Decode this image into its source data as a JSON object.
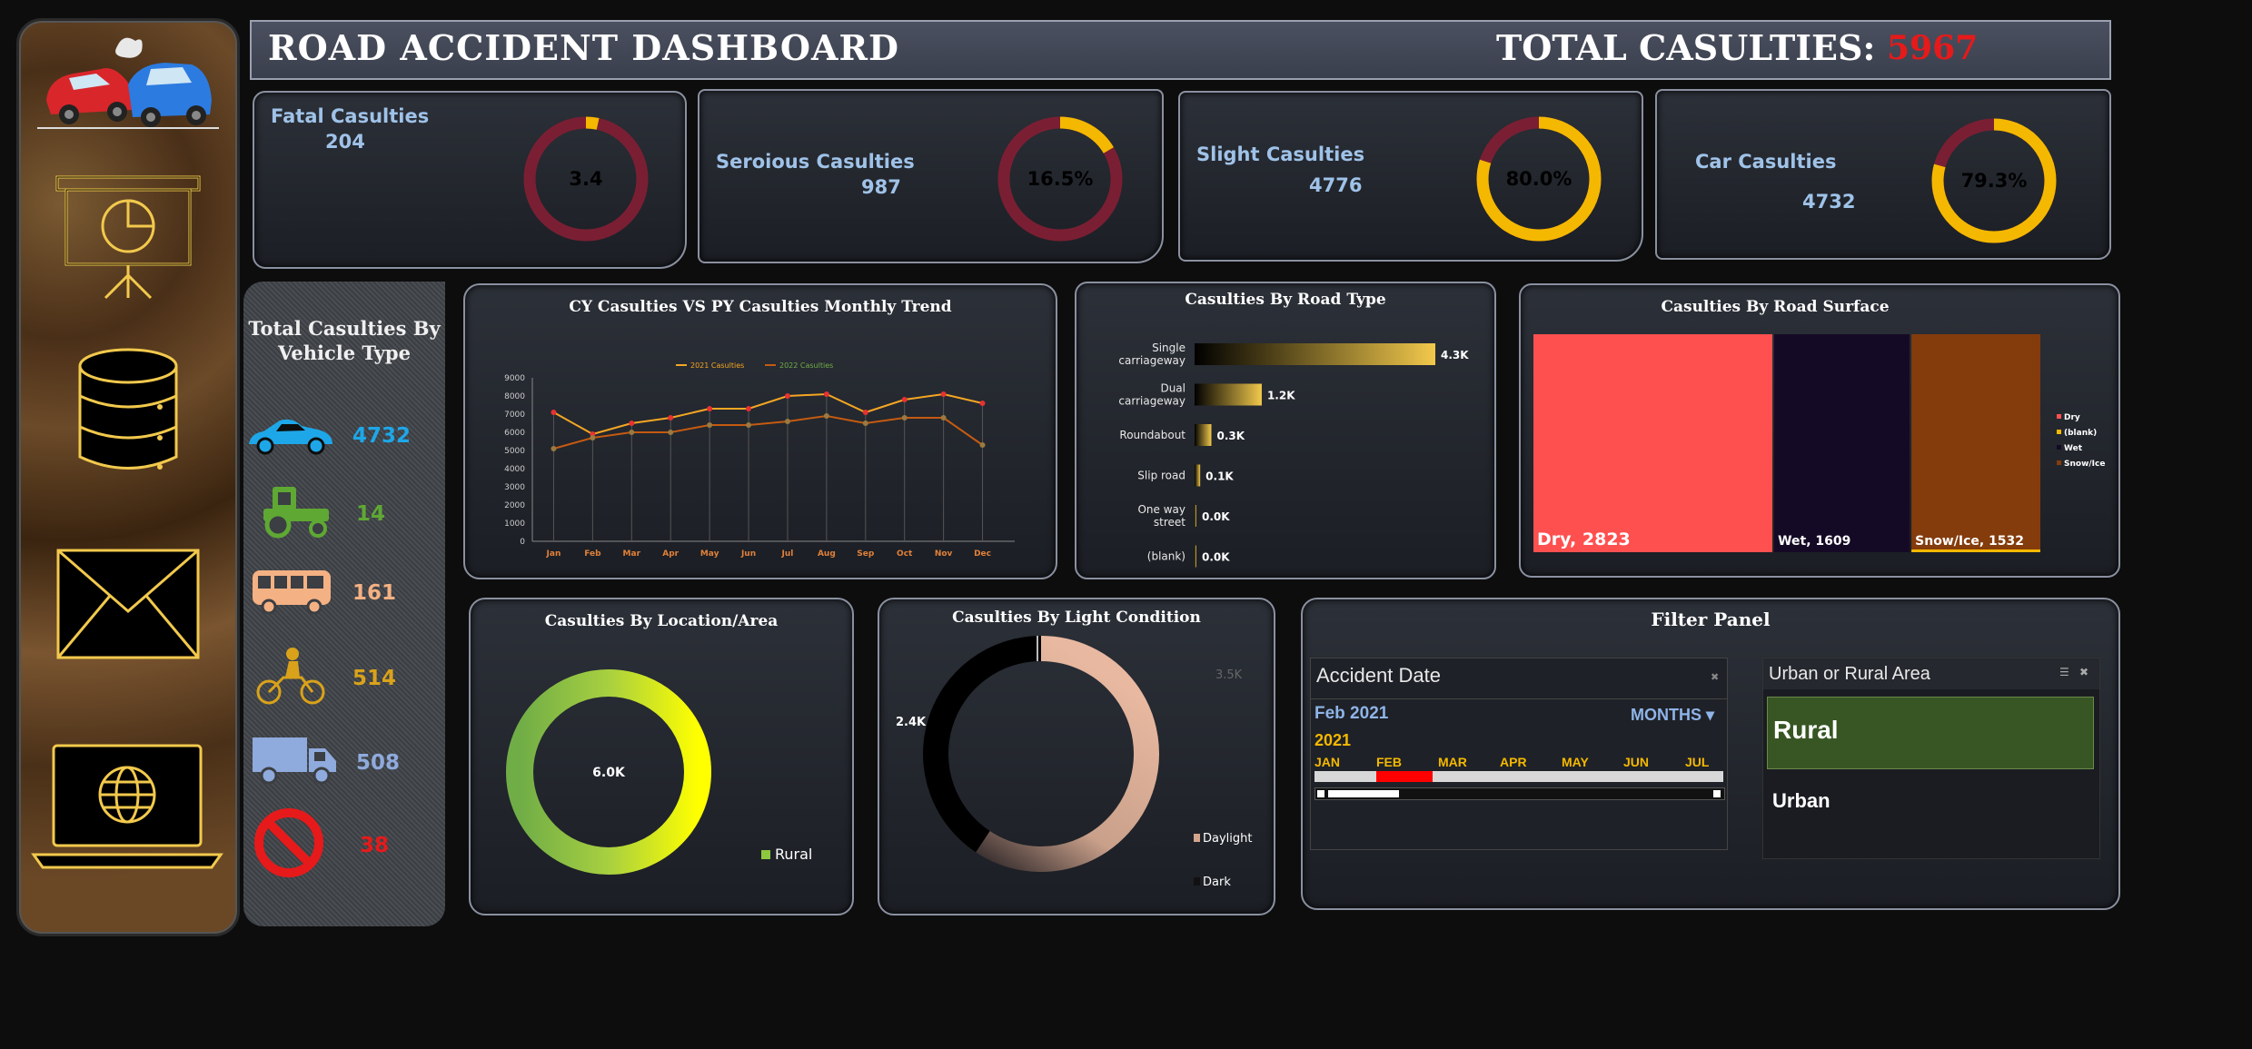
{
  "header": {
    "title": "ROAD ACCIDENT DASHBOARD",
    "total_label": "TOTAL CASULTIES:",
    "total_value": "5967"
  },
  "colors": {
    "accent_gold": "#f5b800",
    "donut_dark": "#7a1f33",
    "value_red": "#e61a1a"
  },
  "sidebar": {
    "icons": [
      "accident-cars-icon",
      "presentation-chart-icon",
      "database-icon",
      "mail-icon",
      "laptop-globe-icon"
    ]
  },
  "kpis": [
    {
      "label": "Fatal Casulties",
      "value": "204",
      "pct_text": "3.4",
      "pct": 3.4
    },
    {
      "label": "Seroious Casulties",
      "value": "987",
      "pct_text": "16.5%",
      "pct": 16.5
    },
    {
      "label": "Slight Casulties",
      "value": "4776",
      "pct_text": "80.0%",
      "pct": 80.0
    },
    {
      "label": "Car Casulties",
      "value": "4732",
      "pct_text": "79.3%",
      "pct": 79.3
    }
  ],
  "vehicle": {
    "title_line1": "Total Casulties By",
    "title_line2": "Vehicle Type",
    "items": [
      {
        "icon": "car-icon",
        "value": "4732",
        "color": "#1ea7e8"
      },
      {
        "icon": "tractor-icon",
        "value": "14",
        "color": "#5ea833"
      },
      {
        "icon": "bus-icon",
        "value": "161",
        "color": "#f4b183"
      },
      {
        "icon": "motorcycle-icon",
        "value": "514",
        "color": "#d9a21a"
      },
      {
        "icon": "truck-icon",
        "value": "508",
        "color": "#8faadc"
      },
      {
        "icon": "prohibited-icon",
        "value": "38",
        "color": "#e61a1a"
      }
    ]
  },
  "chart_data": [
    {
      "type": "line",
      "title": "CY Casulties VS PY Casulties Monthly Trend",
      "categories": [
        "Jan",
        "Feb",
        "Mar",
        "Apr",
        "May",
        "Jun",
        "Jul",
        "Aug",
        "Sep",
        "Oct",
        "Nov",
        "Dec"
      ],
      "series": [
        {
          "name": "2021 Casulties",
          "values": [
            7100,
            5900,
            6500,
            6800,
            7300,
            7300,
            8000,
            8100,
            7100,
            7800,
            8100,
            7600
          ],
          "color": "#f5a623"
        },
        {
          "name": "2022 Casulties",
          "values": [
            5100,
            5700,
            6000,
            6000,
            6400,
            6400,
            6600,
            6900,
            6500,
            6800,
            6800,
            5300
          ],
          "color": "#c55a11"
        }
      ],
      "yticks": [
        "0",
        "1000",
        "2000",
        "3000",
        "4000",
        "5000",
        "6000",
        "7000",
        "8000",
        "9000"
      ],
      "ylim": [
        0,
        9000
      ]
    },
    {
      "type": "bar",
      "title": "Casulties By Road Type",
      "categories": [
        "Single carriageway",
        "Dual carriageway",
        "Roundabout",
        "Slip road",
        "One way street",
        "(blank)"
      ],
      "cat_lines": [
        [
          "Single",
          "carriageway"
        ],
        [
          "Dual",
          "carriageway"
        ],
        [
          "Roundabout"
        ],
        [
          "Slip road"
        ],
        [
          "One way",
          "street"
        ],
        [
          "(blank)"
        ]
      ],
      "values": [
        4.3,
        1.2,
        0.3,
        0.1,
        0.0,
        0.0
      ],
      "labels": [
        "4.3K",
        "1.2K",
        "0.3K",
        "0.1K",
        "0.0K",
        "0.0K"
      ]
    },
    {
      "type": "heatmap",
      "title": "Casulties By Road Surface",
      "tiles": [
        {
          "name": "Dry",
          "value": 2823,
          "label": "Dry, 2823",
          "color": "#ff5050"
        },
        {
          "name": "Wet",
          "value": 1609,
          "label": "Wet, 1609",
          "color": "#150a25"
        },
        {
          "name": "Snow/Ice",
          "value": 1532,
          "label": "Snow/Ice, 1532",
          "color": "#843c0c"
        }
      ],
      "legend": [
        {
          "name": "Dry",
          "color": "#ff5050"
        },
        {
          "name": "(blank)",
          "color": "#f5b800"
        },
        {
          "name": "Wet",
          "color": "#150a25"
        },
        {
          "name": "Snow/Ice",
          "color": "#843c0c"
        }
      ]
    },
    {
      "type": "pie",
      "title": "Casulties By Location/Area",
      "center_label": "6.0K",
      "slices": [
        {
          "name": "Rural",
          "value": 6.0
        }
      ],
      "legend": [
        "Rural"
      ]
    },
    {
      "type": "pie",
      "title": "Casulties By Light Condition",
      "slices": [
        {
          "name": "Daylight",
          "value": 3.5,
          "label": "3.5K"
        },
        {
          "name": "Dark",
          "value": 2.4,
          "label": "2.4K"
        }
      ],
      "legend": [
        "Daylight",
        "Dark"
      ]
    }
  ],
  "filter_panel": {
    "title": "Filter Panel",
    "date_slicer": {
      "title": "Accident Date",
      "selected": "Feb 2021",
      "level": "MONTHS",
      "year": "2021",
      "months": [
        "JAN",
        "FEB",
        "MAR",
        "APR",
        "MAY",
        "JUN",
        "JUL"
      ],
      "selected_month": "FEB"
    },
    "area_slicer": {
      "title": "Urban or Rural Area",
      "options": [
        "Rural",
        "Urban"
      ],
      "selected": "Rural"
    }
  }
}
